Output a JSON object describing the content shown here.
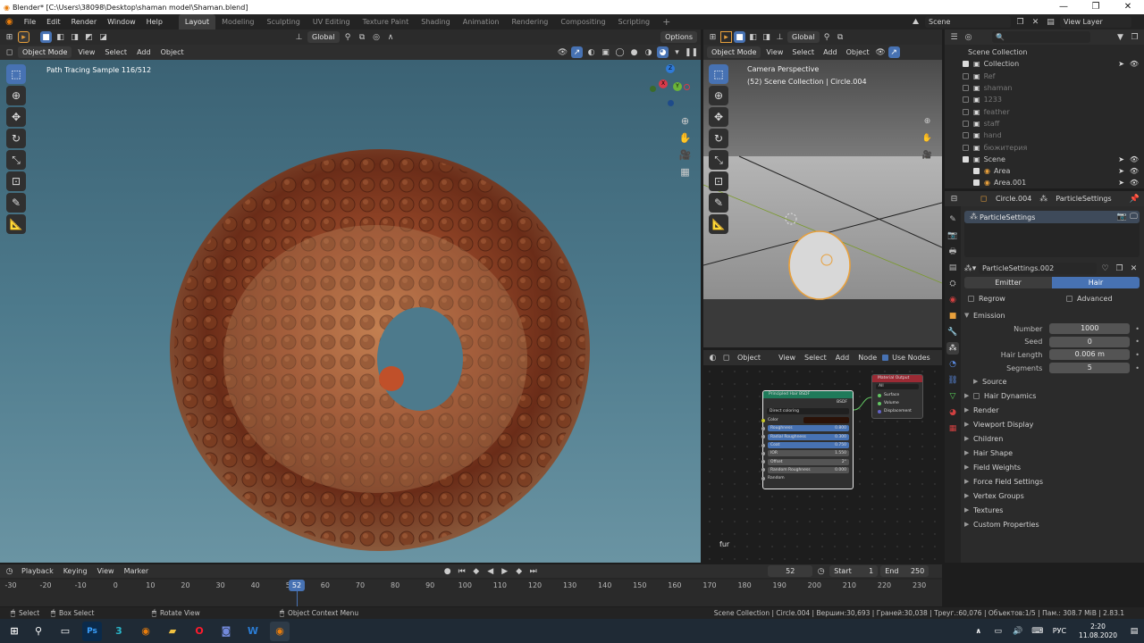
{
  "window": {
    "title": "Blender* [C:\\Users\\38098\\Desktop\\shaman model\\Shaman.blend]",
    "controls": [
      "—",
      "❐",
      "✕"
    ]
  },
  "menu": {
    "items": [
      "File",
      "Edit",
      "Render",
      "Window",
      "Help"
    ],
    "workspaces": [
      "Layout",
      "Modeling",
      "Sculpting",
      "UV Editing",
      "Texture Paint",
      "Shading",
      "Animation",
      "Rendering",
      "Compositing",
      "Scripting"
    ],
    "add_workspace": "+",
    "scene": "Scene",
    "view_layer": "View Layer"
  },
  "viewport_main": {
    "orientation": "Global",
    "options_label": "Options",
    "mode": "Object Mode",
    "header_menus": [
      "View",
      "Select",
      "Add",
      "Object"
    ],
    "status_text": "Path Tracing Sample 116/512",
    "gizmo": {
      "x": "X",
      "y": "Y",
      "z": "Z"
    }
  },
  "viewport_camera": {
    "orientation": "Global",
    "mode": "Object Mode",
    "header_menus": [
      "View",
      "Select",
      "Add",
      "Object"
    ],
    "title": "Camera Perspective",
    "subtitle": "(52) Scene Collection | Circle.004"
  },
  "node_editor": {
    "type": "Object",
    "header_menus": [
      "View",
      "Select",
      "Add",
      "Node"
    ],
    "use_nodes_label": "Use Nodes",
    "use_nodes": true,
    "material_name": "fur",
    "bsdf_node": {
      "title": "Principled Hair BSDF",
      "output": "BSDF",
      "mode": "Direct coloring",
      "inputs": [
        {
          "label": "Color",
          "value": ""
        },
        {
          "label": "Roughness",
          "value": "0.800"
        },
        {
          "label": "Radial Roughness",
          "value": "0.300"
        },
        {
          "label": "Coat",
          "value": "0.750"
        },
        {
          "label": "IOR",
          "value": "1.550"
        },
        {
          "label": "Offset",
          "value": "2°"
        },
        {
          "label": "Random Roughness",
          "value": "0.000"
        },
        {
          "label": "Random",
          "value": ""
        }
      ]
    },
    "output_node": {
      "title": "Material Output",
      "target": "All",
      "inputs": [
        "Surface",
        "Volume",
        "Displacement"
      ]
    }
  },
  "outliner": {
    "root": "Scene Collection",
    "items": [
      {
        "name": "Collection",
        "enabled": true,
        "indent": 0
      },
      {
        "name": "Ref",
        "enabled": false,
        "indent": 0
      },
      {
        "name": "shaman",
        "enabled": false,
        "indent": 0
      },
      {
        "name": "1233",
        "enabled": false,
        "indent": 0
      },
      {
        "name": "feather",
        "enabled": false,
        "indent": 0
      },
      {
        "name": "staff",
        "enabled": false,
        "indent": 0
      },
      {
        "name": "hand",
        "enabled": false,
        "indent": 0
      },
      {
        "name": "бюжитерия",
        "enabled": false,
        "indent": 0
      },
      {
        "name": "Scene",
        "enabled": true,
        "indent": 0
      },
      {
        "name": "Area",
        "enabled": true,
        "indent": 1
      },
      {
        "name": "Area.001",
        "enabled": true,
        "indent": 1
      }
    ]
  },
  "properties": {
    "object": "Circle.004",
    "context": "ParticleSettings",
    "system_list": [
      "ParticleSettings"
    ],
    "settings_name": "ParticleSettings.002",
    "type_options": [
      "Emitter",
      "Hair"
    ],
    "type_selected": "Hair",
    "regrow_label": "Regrow",
    "advanced_label": "Advanced",
    "emission": {
      "title": "Emission",
      "fields": [
        {
          "label": "Number",
          "value": "1000"
        },
        {
          "label": "Seed",
          "value": "0"
        },
        {
          "label": "Hair Length",
          "value": "0.006 m"
        },
        {
          "label": "Segments",
          "value": "5"
        }
      ],
      "source_label": "Source"
    },
    "panels": [
      "Hair Dynamics",
      "Render",
      "Viewport Display",
      "Children",
      "Hair Shape",
      "Field Weights",
      "Force Field Settings",
      "Vertex Groups",
      "Textures",
      "Custom Properties"
    ]
  },
  "timeline": {
    "menus": [
      "Playback",
      "Keying",
      "View",
      "Marker"
    ],
    "current_frame": "52",
    "start_label": "Start",
    "start": "1",
    "end_label": "End",
    "end": "250",
    "ticks": [
      "-30",
      "-20",
      "-10",
      "0",
      "10",
      "20",
      "30",
      "40",
      "50",
      "60",
      "70",
      "80",
      "90",
      "100",
      "110",
      "120",
      "130",
      "140",
      "150",
      "160",
      "170",
      "180",
      "190",
      "200",
      "210",
      "220",
      "230"
    ],
    "playhead": "52"
  },
  "statusbar": {
    "select": "Select",
    "box_select": "Box Select",
    "rotate_view": "Rotate View",
    "context_menu": "Object Context Menu",
    "stats": "Scene Collection | Circle.004 | Вершин:30,693 | Граней:30,038 | Треуг.:60,076 | Объектов:1/5 | Пам.: 308.7 MiB | 2.83.1"
  },
  "taskbar": {
    "language": "РУС",
    "time": "2:20",
    "date": "11.08.2020"
  },
  "colors": {
    "accent": "#4772b3",
    "active_orange": "#e8a03c",
    "viewport_bg_top": "#3a5f70",
    "viewport_bg_bottom": "#5a8a9c"
  }
}
